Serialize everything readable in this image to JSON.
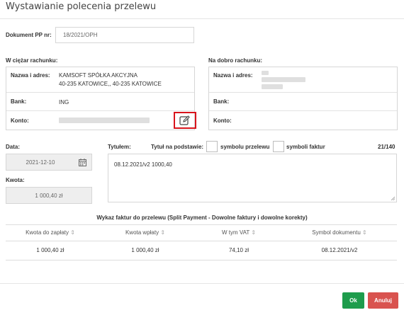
{
  "dialog": {
    "title": "Wystawianie polecenia przelewu"
  },
  "document": {
    "label": "Dokument PP nr:",
    "value": "18/2021/OPH"
  },
  "debit": {
    "header": "W ciężar rachunku:",
    "name_label": "Nazwa i adres:",
    "name_line1": "KAMSOFT SPÓŁKA AKCYJNA",
    "name_line2": "40-235 KATOWICE,, 40-235 KATOWICE",
    "bank_label": "Bank:",
    "bank_value": "ING",
    "account_label": "Konto:",
    "edit_icon": "edit-icon"
  },
  "credit": {
    "header": "Na dobro rachunku:",
    "name_label": "Nazwa i adres:",
    "bank_label": "Bank:",
    "account_label": "Konto:"
  },
  "date": {
    "label": "Data:",
    "value": "2021-12-10",
    "icon": "calendar-icon"
  },
  "amount": {
    "label": "Kwota:",
    "value": "1 000,40 zł"
  },
  "title_field": {
    "label": "Tytułem:",
    "basis_label": "Tytuł na podstawie:",
    "option1": "symbolu przelewu",
    "option2": "symboli faktur",
    "counter": "21/140",
    "value": "08.12.2021/v2 1000,40"
  },
  "invoices": {
    "caption": "Wykaz faktur do przelewu (Split Payment - Dowolne faktury i dowolne korekty)",
    "columns": [
      "Kwota do zapłaty",
      "Kwota wpłaty",
      "W tym VAT",
      "Symbol dokumentu"
    ],
    "rows": [
      [
        "1 000,40 zł",
        "1 000,40 zł",
        "74,10 zł",
        "08.12.2021/v2"
      ]
    ]
  },
  "buttons": {
    "ok": "Ok",
    "cancel": "Anuluj"
  },
  "colors": {
    "ok": "#1e9c4c",
    "cancel": "#d9534f",
    "highlight": "#d9141c"
  }
}
